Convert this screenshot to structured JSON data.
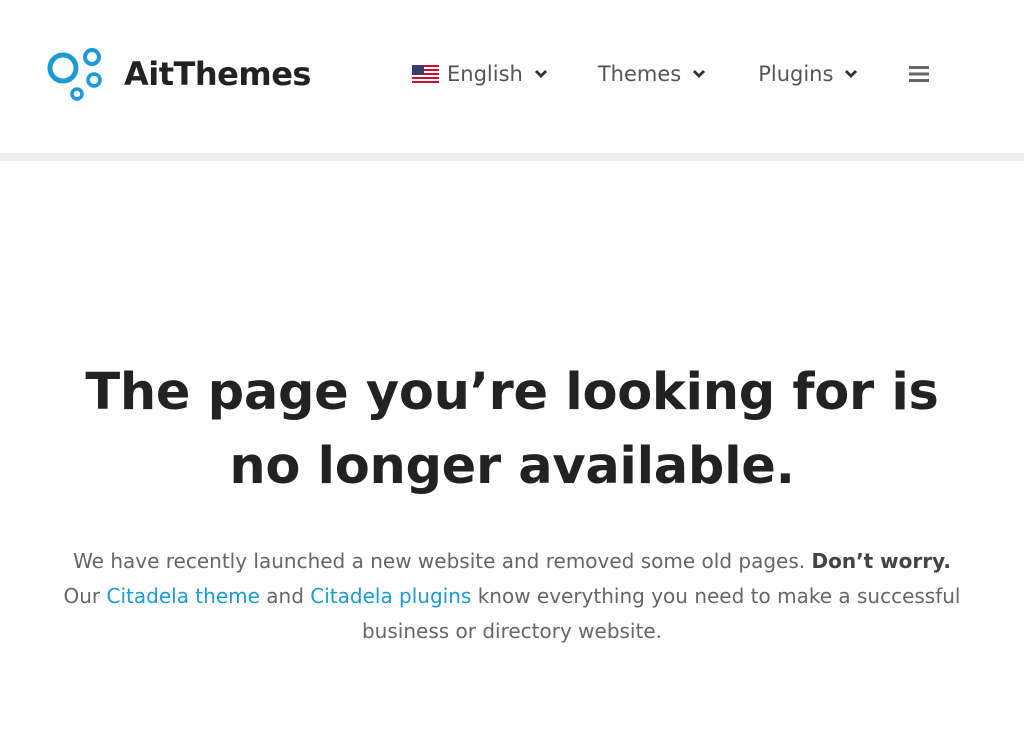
{
  "brand": {
    "name": "AitThemes",
    "accent": "#1a9bd7"
  },
  "nav": {
    "language": {
      "label": "English",
      "flag": "us-flag-icon"
    },
    "themes": {
      "label": "Themes"
    },
    "plugins": {
      "label": "Plugins"
    },
    "menu_icon": "hamburger-icon"
  },
  "hero": {
    "headline": "The page you’re looking for is no longer available.",
    "lead": {
      "part1": "We have recently launched a new website and removed some old pages. ",
      "bold": "Don’t worry.",
      "part2": " Our ",
      "link1": "Citadela theme",
      "part3": " and ",
      "link2": "Citadela plugins",
      "part4": " know everything you need to make a successful business or directory website."
    }
  }
}
